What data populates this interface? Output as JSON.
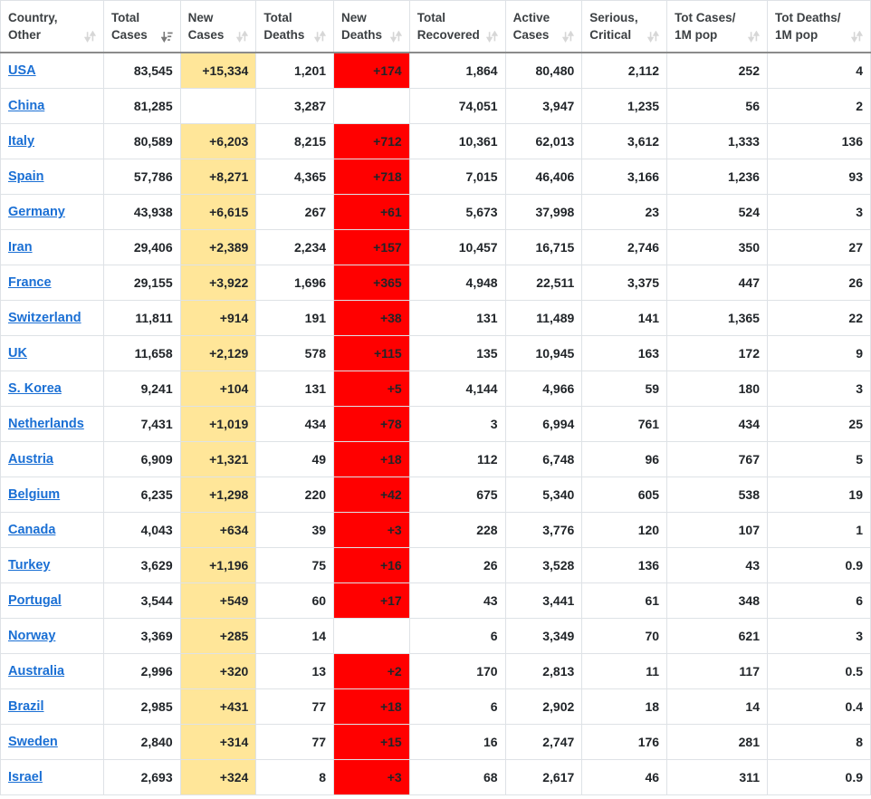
{
  "table": {
    "columns": [
      {
        "label_line1": "Country,",
        "label_line2": "Other",
        "sort": "sort-both-icon",
        "key": "country"
      },
      {
        "label_line1": "Total",
        "label_line2": "Cases",
        "sort": "sort-down-icon",
        "key": "total_cases"
      },
      {
        "label_line1": "New",
        "label_line2": "Cases",
        "sort": "sort-both-icon",
        "key": "new_cases"
      },
      {
        "label_line1": "Total",
        "label_line2": "Deaths",
        "sort": "sort-both-icon",
        "key": "total_deaths"
      },
      {
        "label_line1": "New",
        "label_line2": "Deaths",
        "sort": "sort-both-icon",
        "key": "new_deaths"
      },
      {
        "label_line1": "Total",
        "label_line2": "Recovered",
        "sort": "sort-both-icon",
        "key": "total_recovered"
      },
      {
        "label_line1": "Active",
        "label_line2": "Cases",
        "sort": "sort-both-icon",
        "key": "active_cases"
      },
      {
        "label_line1": "Serious,",
        "label_line2": "Critical",
        "sort": "sort-both-icon",
        "key": "serious_critical"
      },
      {
        "label_line1": "Tot Cases/",
        "label_line2": "1M pop",
        "sort": "sort-both-icon",
        "key": "cases_per_million"
      },
      {
        "label_line1": "Tot Deaths/",
        "label_line2": "1M pop",
        "sort": "sort-both-icon",
        "key": "deaths_per_million"
      }
    ],
    "rows": [
      {
        "country": "USA",
        "total_cases": "83,545",
        "new_cases": "+15,334",
        "total_deaths": "1,201",
        "new_deaths": "+174",
        "total_recovered": "1,864",
        "active_cases": "80,480",
        "serious_critical": "2,112",
        "cases_per_million": "252",
        "deaths_per_million": "4"
      },
      {
        "country": "China",
        "total_cases": "81,285",
        "new_cases": "",
        "total_deaths": "3,287",
        "new_deaths": "",
        "total_recovered": "74,051",
        "active_cases": "3,947",
        "serious_critical": "1,235",
        "cases_per_million": "56",
        "deaths_per_million": "2"
      },
      {
        "country": "Italy",
        "total_cases": "80,589",
        "new_cases": "+6,203",
        "total_deaths": "8,215",
        "new_deaths": "+712",
        "total_recovered": "10,361",
        "active_cases": "62,013",
        "serious_critical": "3,612",
        "cases_per_million": "1,333",
        "deaths_per_million": "136"
      },
      {
        "country": "Spain",
        "total_cases": "57,786",
        "new_cases": "+8,271",
        "total_deaths": "4,365",
        "new_deaths": "+718",
        "total_recovered": "7,015",
        "active_cases": "46,406",
        "serious_critical": "3,166",
        "cases_per_million": "1,236",
        "deaths_per_million": "93"
      },
      {
        "country": "Germany",
        "total_cases": "43,938",
        "new_cases": "+6,615",
        "total_deaths": "267",
        "new_deaths": "+61",
        "total_recovered": "5,673",
        "active_cases": "37,998",
        "serious_critical": "23",
        "cases_per_million": "524",
        "deaths_per_million": "3"
      },
      {
        "country": "Iran",
        "total_cases": "29,406",
        "new_cases": "+2,389",
        "total_deaths": "2,234",
        "new_deaths": "+157",
        "total_recovered": "10,457",
        "active_cases": "16,715",
        "serious_critical": "2,746",
        "cases_per_million": "350",
        "deaths_per_million": "27"
      },
      {
        "country": "France",
        "total_cases": "29,155",
        "new_cases": "+3,922",
        "total_deaths": "1,696",
        "new_deaths": "+365",
        "total_recovered": "4,948",
        "active_cases": "22,511",
        "serious_critical": "3,375",
        "cases_per_million": "447",
        "deaths_per_million": "26"
      },
      {
        "country": "Switzerland",
        "total_cases": "11,811",
        "new_cases": "+914",
        "total_deaths": "191",
        "new_deaths": "+38",
        "total_recovered": "131",
        "active_cases": "11,489",
        "serious_critical": "141",
        "cases_per_million": "1,365",
        "deaths_per_million": "22"
      },
      {
        "country": "UK",
        "total_cases": "11,658",
        "new_cases": "+2,129",
        "total_deaths": "578",
        "new_deaths": "+115",
        "total_recovered": "135",
        "active_cases": "10,945",
        "serious_critical": "163",
        "cases_per_million": "172",
        "deaths_per_million": "9"
      },
      {
        "country": "S. Korea",
        "total_cases": "9,241",
        "new_cases": "+104",
        "total_deaths": "131",
        "new_deaths": "+5",
        "total_recovered": "4,144",
        "active_cases": "4,966",
        "serious_critical": "59",
        "cases_per_million": "180",
        "deaths_per_million": "3"
      },
      {
        "country": "Netherlands",
        "total_cases": "7,431",
        "new_cases": "+1,019",
        "total_deaths": "434",
        "new_deaths": "+78",
        "total_recovered": "3",
        "active_cases": "6,994",
        "serious_critical": "761",
        "cases_per_million": "434",
        "deaths_per_million": "25"
      },
      {
        "country": "Austria",
        "total_cases": "6,909",
        "new_cases": "+1,321",
        "total_deaths": "49",
        "new_deaths": "+18",
        "total_recovered": "112",
        "active_cases": "6,748",
        "serious_critical": "96",
        "cases_per_million": "767",
        "deaths_per_million": "5"
      },
      {
        "country": "Belgium",
        "total_cases": "6,235",
        "new_cases": "+1,298",
        "total_deaths": "220",
        "new_deaths": "+42",
        "total_recovered": "675",
        "active_cases": "5,340",
        "serious_critical": "605",
        "cases_per_million": "538",
        "deaths_per_million": "19"
      },
      {
        "country": "Canada",
        "total_cases": "4,043",
        "new_cases": "+634",
        "total_deaths": "39",
        "new_deaths": "+3",
        "total_recovered": "228",
        "active_cases": "3,776",
        "serious_critical": "120",
        "cases_per_million": "107",
        "deaths_per_million": "1"
      },
      {
        "country": "Turkey",
        "total_cases": "3,629",
        "new_cases": "+1,196",
        "total_deaths": "75",
        "new_deaths": "+16",
        "total_recovered": "26",
        "active_cases": "3,528",
        "serious_critical": "136",
        "cases_per_million": "43",
        "deaths_per_million": "0.9"
      },
      {
        "country": "Portugal",
        "total_cases": "3,544",
        "new_cases": "+549",
        "total_deaths": "60",
        "new_deaths": "+17",
        "total_recovered": "43",
        "active_cases": "3,441",
        "serious_critical": "61",
        "cases_per_million": "348",
        "deaths_per_million": "6"
      },
      {
        "country": "Norway",
        "total_cases": "3,369",
        "new_cases": "+285",
        "total_deaths": "14",
        "new_deaths": "",
        "total_recovered": "6",
        "active_cases": "3,349",
        "serious_critical": "70",
        "cases_per_million": "621",
        "deaths_per_million": "3"
      },
      {
        "country": "Australia",
        "total_cases": "2,996",
        "new_cases": "+320",
        "total_deaths": "13",
        "new_deaths": "+2",
        "total_recovered": "170",
        "active_cases": "2,813",
        "serious_critical": "11",
        "cases_per_million": "117",
        "deaths_per_million": "0.5"
      },
      {
        "country": "Brazil",
        "total_cases": "2,985",
        "new_cases": "+431",
        "total_deaths": "77",
        "new_deaths": "+18",
        "total_recovered": "6",
        "active_cases": "2,902",
        "serious_critical": "18",
        "cases_per_million": "14",
        "deaths_per_million": "0.4"
      },
      {
        "country": "Sweden",
        "total_cases": "2,840",
        "new_cases": "+314",
        "total_deaths": "77",
        "new_deaths": "+15",
        "total_recovered": "16",
        "active_cases": "2,747",
        "serious_critical": "176",
        "cases_per_million": "281",
        "deaths_per_million": "8"
      },
      {
        "country": "Israel",
        "total_cases": "2,693",
        "new_cases": "+324",
        "total_deaths": "8",
        "new_deaths": "+3",
        "total_recovered": "68",
        "active_cases": "2,617",
        "serious_critical": "46",
        "cases_per_million": "311",
        "deaths_per_million": "0.9"
      }
    ],
    "colors": {
      "new_cases_highlight": "#ffe699",
      "new_deaths_highlight": "#ff0000",
      "link": "#1a6fd4",
      "border": "#dee2e6",
      "header_text": "#3c4043"
    }
  }
}
